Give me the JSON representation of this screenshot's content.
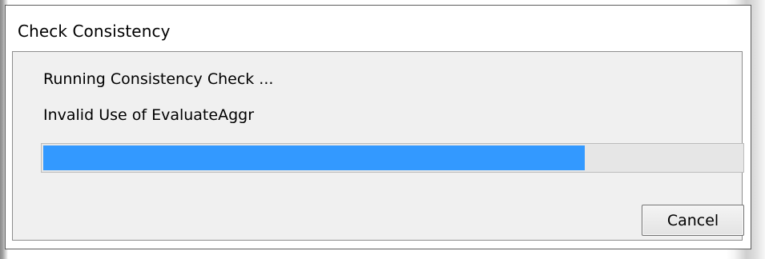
{
  "window": {
    "title": "Check Consistency"
  },
  "status": {
    "line1": "Running Consistency Check ...",
    "line2": "Invalid Use of EvaluateAggr"
  },
  "progress": {
    "fraction": 0.775,
    "color": "#3399ff"
  },
  "buttons": {
    "cancel_label": "Cancel"
  }
}
